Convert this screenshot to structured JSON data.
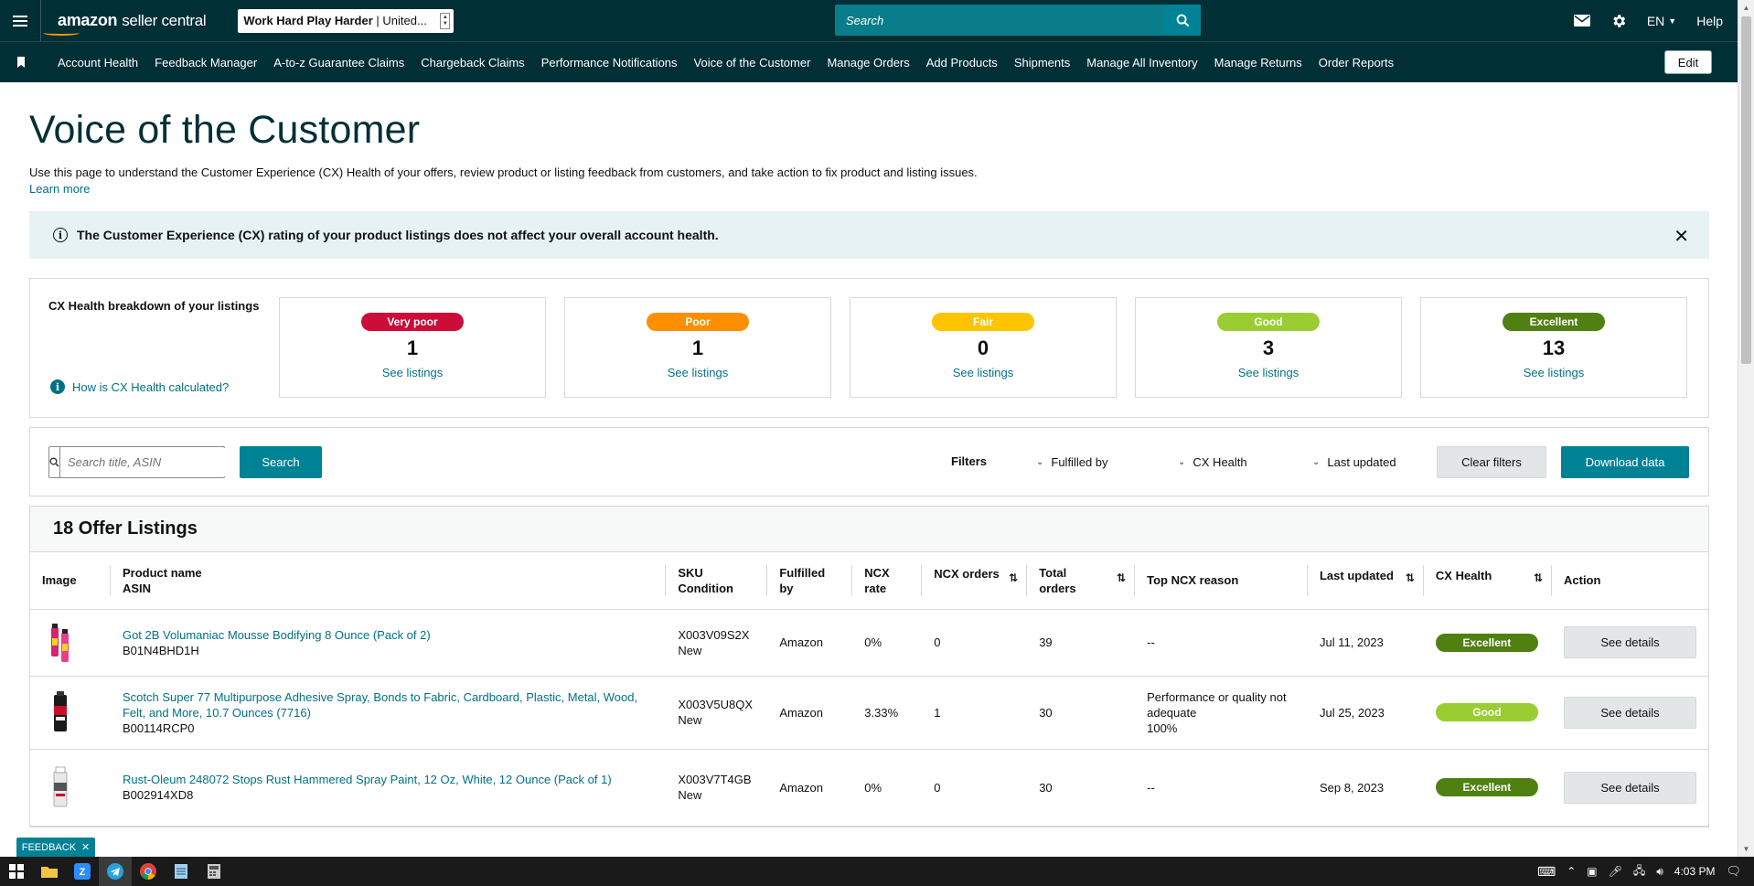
{
  "topbar": {
    "logo_brand": "amazon",
    "logo_suffix": "seller central",
    "store_name": "Work Hard Play Harder",
    "store_region": "| United...",
    "search_placeholder": "Search",
    "language": "EN",
    "help_label": "Help",
    "icons": [
      "menu-icon",
      "search-icon",
      "mail-icon",
      "gear-icon",
      "caret-down-icon"
    ]
  },
  "subnav": {
    "items": [
      "Account Health",
      "Feedback Manager",
      "A-to-z Guarantee Claims",
      "Chargeback Claims",
      "Performance Notifications",
      "Voice of the Customer",
      "Manage Orders",
      "Add Products",
      "Shipments",
      "Manage All Inventory",
      "Manage Returns",
      "Order Reports"
    ],
    "edit_label": "Edit"
  },
  "page": {
    "title": "Voice of the Customer",
    "intro": "Use this page to understand the Customer Experience (CX) Health of your offers, review product or listing feedback from customers, and take action to fix product and listing issues.",
    "learn_more": "Learn more",
    "alert": "The Customer Experience (CX) rating of your product listings does not affect your overall account health."
  },
  "cx_breakdown": {
    "title": "CX Health breakdown of your listings",
    "how_link": "How is CX Health calculated?",
    "cards": [
      {
        "label": "Very poor",
        "count": "1",
        "link": "See listings",
        "color": "#cc0c39"
      },
      {
        "label": "Poor",
        "count": "1",
        "link": "See listings",
        "color": "#ff8f00"
      },
      {
        "label": "Fair",
        "count": "0",
        "link": "See listings",
        "color": "#ffc400"
      },
      {
        "label": "Good",
        "count": "3",
        "link": "See listings",
        "color": "#9acd32"
      },
      {
        "label": "Excellent",
        "count": "13",
        "link": "See listings",
        "color": "#507f12"
      }
    ]
  },
  "filters": {
    "search_placeholder": "Search title, ASIN",
    "search_button": "Search",
    "filters_label": "Filters",
    "fulfilled_by": "Fulfilled by",
    "cx_health": "CX Health",
    "last_updated": "Last updated",
    "clear_filters": "Clear filters",
    "download_data": "Download data"
  },
  "listings": {
    "heading": "18 Offer Listings",
    "columns": {
      "image": "Image",
      "product_name": "Product name",
      "asin": "ASIN",
      "sku": "SKU",
      "condition": "Condition",
      "fulfilled_by": "Fulfilled by",
      "ncx_rate": "NCX rate",
      "ncx_orders": "NCX orders",
      "total_orders_1": "Total",
      "total_orders_2": "orders",
      "top_ncx_reason": "Top NCX reason",
      "last_updated": "Last updated",
      "cx_health": "CX Health",
      "action": "Action"
    },
    "rows": [
      {
        "name": "Got 2B Volumaniac Mousse Bodifying 8 Ounce (Pack of 2)",
        "asin": "B01N4BHD1H",
        "sku": "X003V09S2X",
        "condition": "New",
        "fulfilled_by": "Amazon",
        "ncx_rate": "0%",
        "ncx_orders": "0",
        "total_orders": "39",
        "reason": "--",
        "reason_pct": "",
        "last_updated": "Jul 11, 2023",
        "cx_health": "Excellent",
        "cx_color": "#507f12",
        "action": "See details"
      },
      {
        "name": "Scotch Super 77 Multipurpose Adhesive Spray, Bonds to Fabric, Cardboard, Plastic, Metal, Wood, Felt, and More, 10.7 Ounces (7716)",
        "asin": "B00114RCP0",
        "sku": "X003V5U8QX",
        "condition": "New",
        "fulfilled_by": "Amazon",
        "ncx_rate": "3.33%",
        "ncx_orders": "1",
        "total_orders": "30",
        "reason": "Performance or quality not adequate",
        "reason_pct": "100%",
        "last_updated": "Jul 25, 2023",
        "cx_health": "Good",
        "cx_color": "#9acd32",
        "action": "See details"
      },
      {
        "name": "Rust-Oleum 248072 Stops Rust Hammered Spray Paint, 12 Oz, White, 12 Ounce (Pack of 1)",
        "asin": "B002914XD8",
        "sku": "X003V7T4GB",
        "condition": "New",
        "fulfilled_by": "Amazon",
        "ncx_rate": "0%",
        "ncx_orders": "0",
        "total_orders": "30",
        "reason": "--",
        "reason_pct": "",
        "last_updated": "Sep 8, 2023",
        "cx_health": "Excellent",
        "cx_color": "#507f12",
        "action": "See details"
      }
    ]
  },
  "feedback_tab": "FEEDBACK",
  "taskbar": {
    "clock": "4:03 PM",
    "apps": [
      "windows-start-icon",
      "file-explorer-icon",
      "zoom-icon",
      "telegram-icon",
      "chrome-icon",
      "notepad-icon",
      "calculator-icon"
    ]
  }
}
